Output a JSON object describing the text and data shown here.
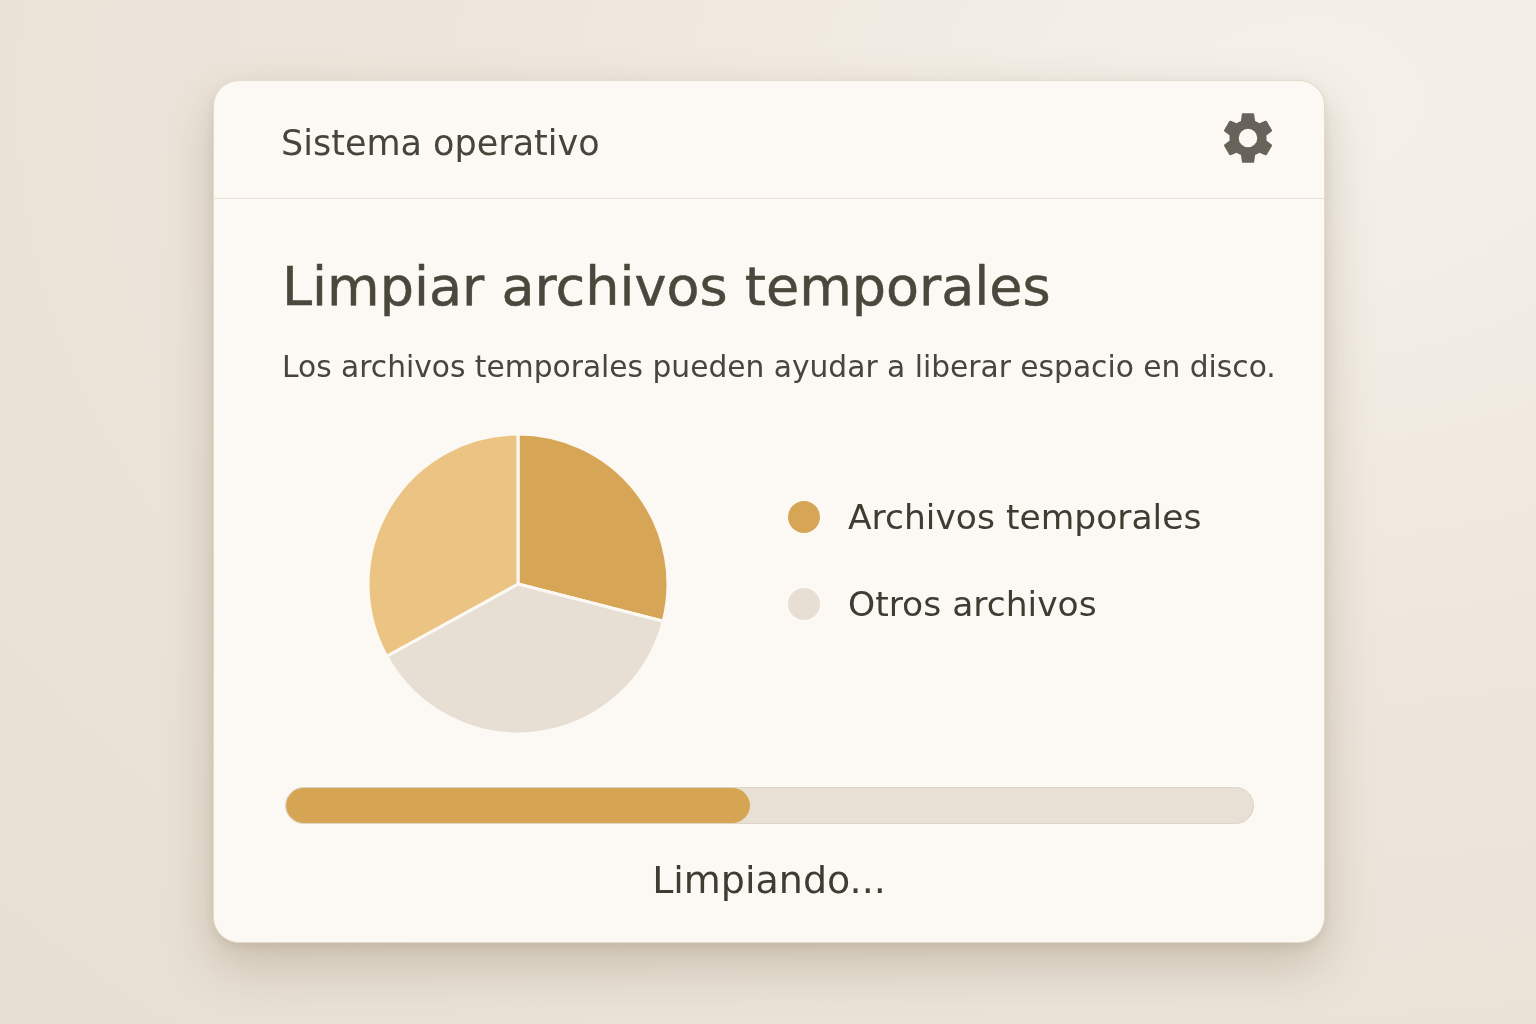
{
  "header": {
    "title": "Sistema operativo"
  },
  "cleanup": {
    "title": "Limpiar archivos temporales",
    "description": "Los archivos temporales pueden ayudar a liberar espacio en disco.",
    "chart_data": {
      "type": "pie",
      "values": [
        29,
        38,
        33
      ],
      "colors": [
        "#d6a555",
        "#e7dfd4",
        "#ebc484"
      ]
    },
    "legend": [
      {
        "label": "Archivos temporales",
        "color": "#d6a555"
      },
      {
        "label": "Otros archivos",
        "color": "#e7dfd4"
      }
    ],
    "progress": {
      "level": 0.48,
      "status": "Limpiando..."
    }
  }
}
